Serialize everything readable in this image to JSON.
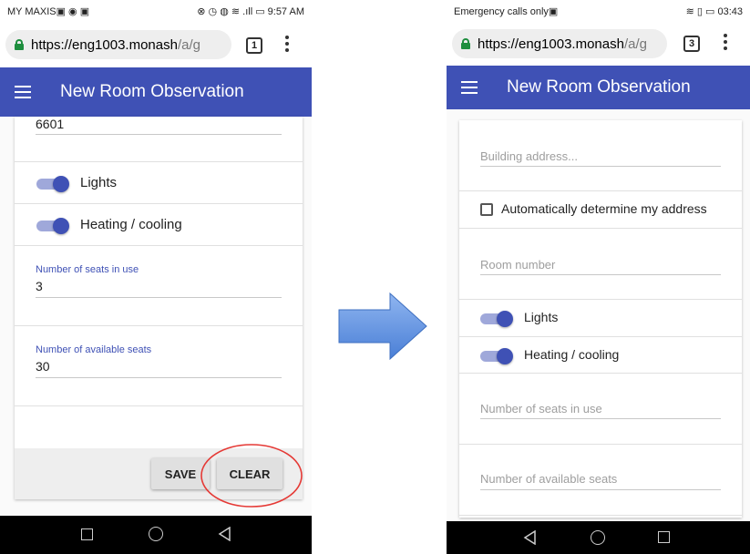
{
  "left_phone": {
    "status_left": "MY MAXIS▣ ◉ ▣",
    "status_right": "⊗ ◷ ◍ ≋ .ıll ▭ 9:57 AM",
    "url_host": "https://eng1003.monash",
    "url_path": "/a/g",
    "tab_count": "1",
    "app_title": "New Room Observation",
    "room_value": "6601",
    "toggles": [
      {
        "label": "Lights",
        "on": true
      },
      {
        "label": "Heating / cooling",
        "on": true
      }
    ],
    "seats_in_use": {
      "label": "Number of seats in use",
      "value": "3"
    },
    "available_seats": {
      "label": "Number of available seats",
      "value": "30"
    },
    "save_label": "SAVE",
    "clear_label": "CLEAR"
  },
  "right_phone": {
    "status_left": "Emergency calls only▣",
    "status_right": "≋ ▯ ▭ 03:43",
    "url_host": "https://eng1003.monash",
    "url_path": "/a/g",
    "tab_count": "3",
    "app_title": "New Room Observation",
    "address_placeholder": "Building address...",
    "auto_address_label": "Automatically determine my address",
    "room_placeholder": "Room number",
    "toggles": [
      {
        "label": "Lights",
        "on": true
      },
      {
        "label": "Heating / cooling",
        "on": true
      }
    ],
    "seats_in_use_placeholder": "Number of seats in use",
    "available_seats_placeholder": "Number of available seats"
  },
  "colors": {
    "app_bar": "#3f51b5",
    "toggle_track": "#9fa8da",
    "arrow": "#5b8ee0",
    "highlight_circle": "#e53935"
  }
}
